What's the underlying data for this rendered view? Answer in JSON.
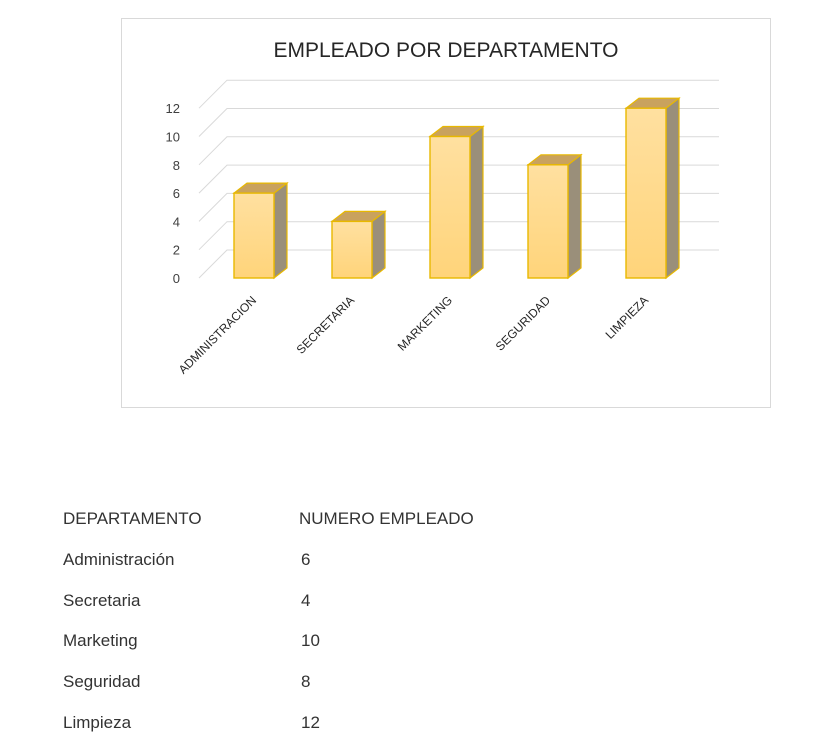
{
  "chart_data": {
    "type": "bar",
    "title": "EMPLEADO POR DEPARTAMENTO",
    "categories": [
      "ADMINISTRACION",
      "SECRETARIA",
      "MARKETING",
      "SEGURIDAD",
      "LIMPIEZA"
    ],
    "values": [
      6,
      4,
      10,
      8,
      12
    ],
    "yticks": [
      0,
      2,
      4,
      6,
      8,
      10,
      12
    ],
    "ylim": [
      0,
      12
    ],
    "xlabel": "",
    "ylabel": "",
    "style": "3d-column",
    "grid": true,
    "legend": "none",
    "colors": {
      "bar_front_top": "#FFE0A0",
      "bar_front_bottom": "#FFD47A",
      "bar_top": "#C9A25E",
      "bar_side": "#9A8F7A",
      "bar_outline": "#E8B800",
      "grid": "#D9D9D9"
    }
  },
  "table": {
    "headers": [
      "DEPARTAMENTO",
      "NUMERO EMPLEADO"
    ],
    "rows": [
      [
        "Administración",
        "6"
      ],
      [
        "Secretaria",
        "4"
      ],
      [
        "Marketing",
        "10"
      ],
      [
        "Seguridad",
        "8"
      ],
      [
        "Limpieza",
        "12"
      ]
    ]
  }
}
